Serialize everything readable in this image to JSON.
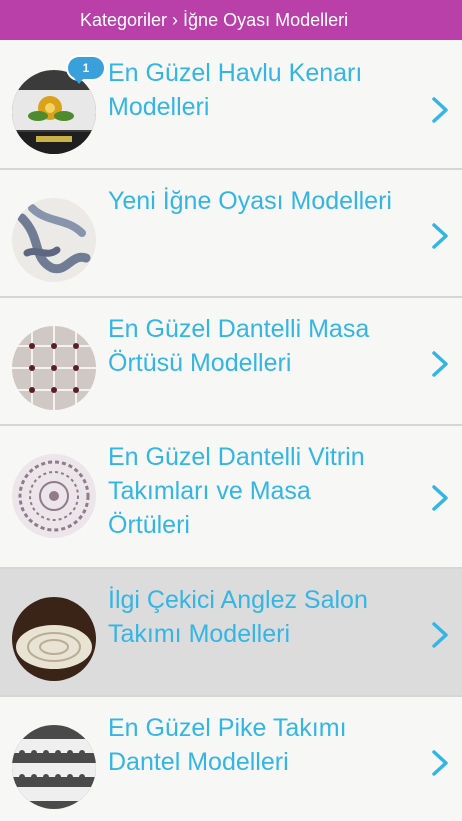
{
  "header": {
    "breadcrumb": "Kategoriler › İğne Oyası Modelleri"
  },
  "colors": {
    "topbar": "#b93fa9",
    "title_text": "#33b5e5",
    "badge": "#3aa0dc",
    "selected_row": "#dcdcdc"
  },
  "items": [
    {
      "title": "En Güzel Havlu Kenarı Modelleri",
      "badge": "1",
      "icon": "chevron-right-icon"
    },
    {
      "title": "Yeni İğne Oyası Modelleri",
      "icon": "chevron-right-icon"
    },
    {
      "title": "En Güzel Dantelli Masa Örtüsü Modelleri",
      "icon": "chevron-right-icon"
    },
    {
      "title": "En Güzel Dantelli Vitrin Takımları ve Masa Örtüleri",
      "icon": "chevron-right-icon"
    },
    {
      "title": "İlgi Çekici Anglez Salon Takımı Modelleri",
      "selected": true,
      "icon": "chevron-right-icon"
    },
    {
      "title": "En Güzel Pike Takımı Dantel Modelleri",
      "icon": "chevron-right-icon"
    }
  ]
}
